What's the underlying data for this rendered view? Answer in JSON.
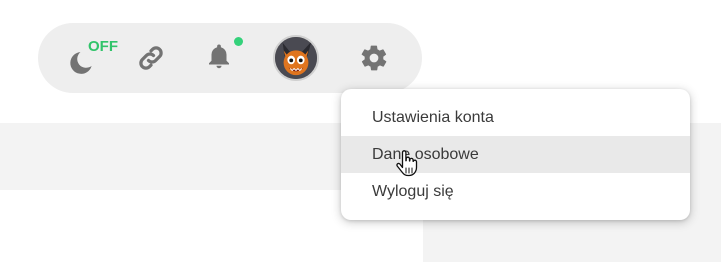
{
  "toolbar": {
    "theme_toggle": {
      "icon": "moon-icon",
      "state_label": "OFF",
      "state_color": "#31c46a"
    },
    "link_icon": "link-icon",
    "notifications": {
      "icon": "bell-icon",
      "indicator_color": "#34d17a"
    },
    "avatar": {
      "icon": "avatar"
    },
    "settings_icon": "gear-icon"
  },
  "menu": {
    "items": [
      {
        "label": "Ustawienia konta"
      },
      {
        "label": "Dane osobowe",
        "hovered": true
      },
      {
        "label": "Wyloguj się"
      }
    ]
  },
  "colors": {
    "toolbar_bg": "#eeeeee",
    "icon_gray": "#737373",
    "page_band": "#f3f3f3",
    "menu_hover": "#e9e9e9"
  }
}
